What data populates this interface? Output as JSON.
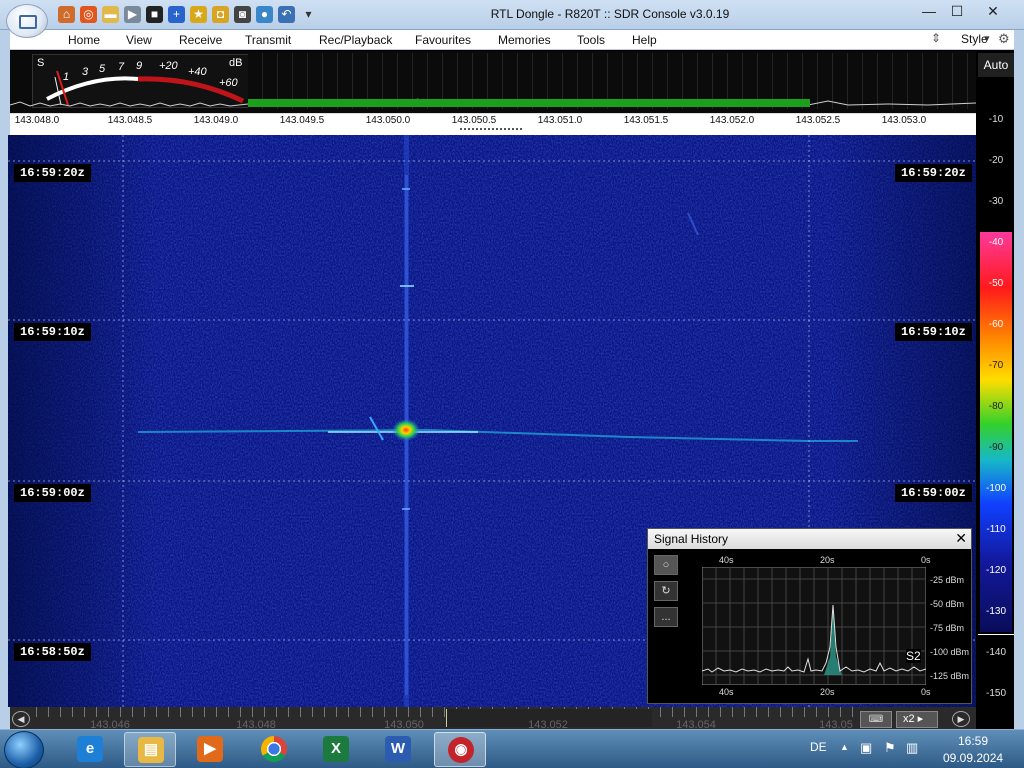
{
  "titlebar": {
    "title": "RTL Dongle - R820T :: SDR Console v3.0.19",
    "minimize": "—",
    "maximize": "☐",
    "close": "✕"
  },
  "menu": {
    "items": [
      "Home",
      "View",
      "Receive",
      "Transmit",
      "Rec/Playback",
      "Favourites",
      "Memories",
      "Tools",
      "Help"
    ],
    "style_label": "Style"
  },
  "smeter": {
    "s_label": "S",
    "db_label": "dB",
    "scale": [
      "1",
      "3",
      "5",
      "7",
      "9",
      "+20",
      "+40",
      "+60"
    ]
  },
  "frequency_axis": {
    "ticks": [
      "143.048.0",
      "143.048.5",
      "143.049.0",
      "143.049.5",
      "143.050.0",
      "143.050.5",
      "143.051.0",
      "143.051.5",
      "143.052.0",
      "143.052.5",
      "143.053.0"
    ]
  },
  "waterfall": {
    "time_labels": [
      "16:59:20z",
      "16:59:10z",
      "16:59:00z",
      "16:58:50z"
    ]
  },
  "db_scale": {
    "auto_label": "Auto",
    "ticks": [
      "-10",
      "-20",
      "-30",
      "-40",
      "-50",
      "-60",
      "-70",
      "-80",
      "-90",
      "-100",
      "-110",
      "-120",
      "-130",
      "-140",
      "-150"
    ]
  },
  "bottom_scroll": {
    "ticks": [
      "143.046",
      "143.048",
      "143.050",
      "143.052",
      "143.054",
      "143.05"
    ],
    "zoom_label": "x2"
  },
  "signal_history": {
    "title": "Signal History",
    "close": "✕",
    "buttons": [
      "○",
      "↻",
      "..."
    ],
    "x_labels_top": [
      "40s",
      "20s",
      "0s"
    ],
    "x_labels_bottom": [
      "40s",
      "20s",
      "0s"
    ],
    "y_labels": [
      "-25 dBm",
      "-50 dBm",
      "-75 dBm",
      "-100 dBm",
      "-125 dBm"
    ],
    "s_unit": "S2"
  },
  "taskbar": {
    "apps": [
      "internet-explorer",
      "file-explorer",
      "media-player",
      "chrome",
      "excel",
      "word",
      "sdr-console"
    ],
    "language": "DE",
    "time": "16:59",
    "date": "09.09.2024"
  },
  "colors": {
    "waterfall_bg": "#0c1380",
    "signal_green": "#1ca01c",
    "title_bar": "#b9cfe8"
  }
}
